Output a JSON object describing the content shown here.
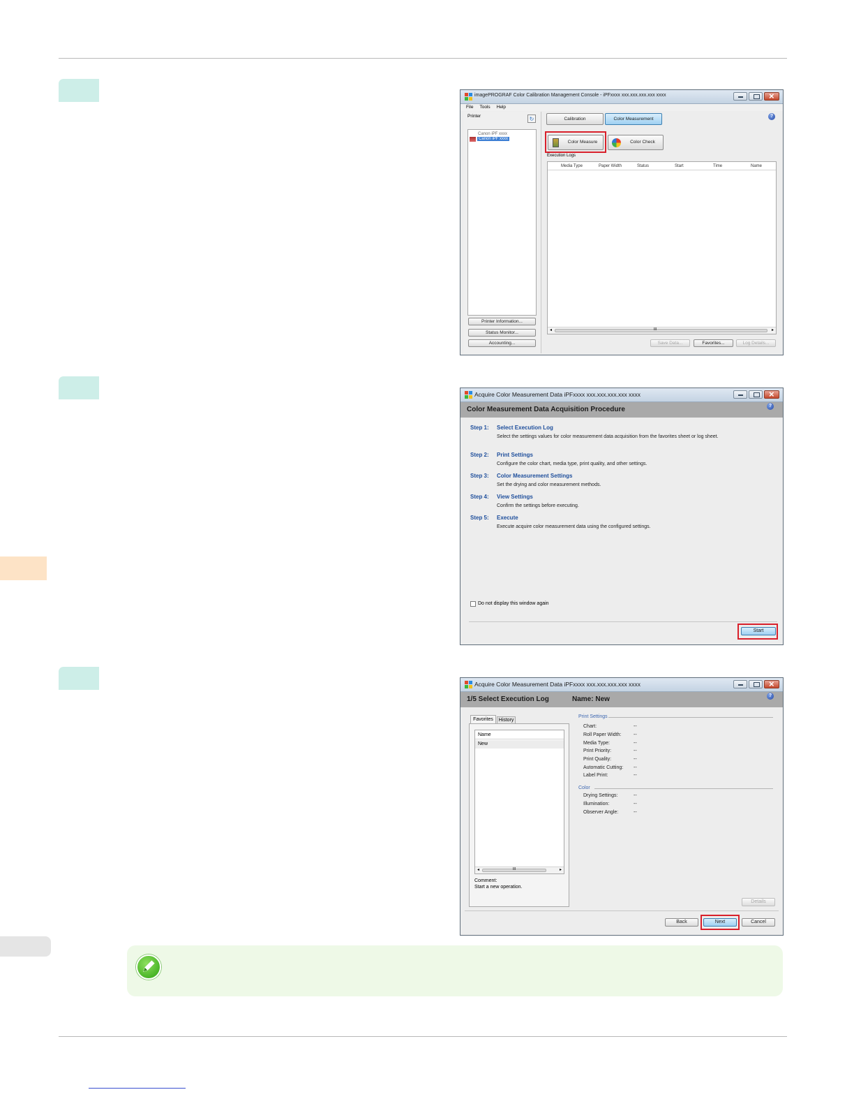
{
  "window1": {
    "title": "imagePROGRAF Color Calibration Management Console - iPFxxxx xxx.xxx.xxx.xxx xxxx",
    "menu": [
      "File",
      "Tools",
      "Help"
    ],
    "printer_label": "Printer",
    "printers": [
      "Canon iPF xxxx",
      "Canon iPF xxxx"
    ],
    "tabs": [
      "Calibration",
      "Color Measurement"
    ],
    "color_measure_button": "Color Measure",
    "color_check_button": "Color Check",
    "execution_logs_label": "Execution Logs",
    "columns": [
      "Media Type",
      "Paper Width",
      "Status",
      "Start",
      "Time",
      "Name"
    ],
    "scroll_mark": "III",
    "left_buttons": [
      "Printer Information...",
      "Status Monitor...",
      "Accounting..."
    ],
    "bottom_buttons": [
      "Save Data...",
      "Favorites...",
      "Log Details..."
    ]
  },
  "window2": {
    "title": "Acquire Color Measurement Data iPFxxxx xxx.xxx.xxx.xxx xxxx",
    "heading": "Color Measurement Data Acquisition Procedure",
    "steps": [
      {
        "num": "Step 1:",
        "title": "Select Execution Log",
        "desc": "Select the settings values for color measurement data acquisition from the favorites sheet or log sheet."
      },
      {
        "num": "Step 2:",
        "title": "Print Settings",
        "desc": "Configure the color chart, media type, print quality, and other settings."
      },
      {
        "num": "Step 3:",
        "title": "Color Measurement Settings",
        "desc": "Set the drying and color measurement methods."
      },
      {
        "num": "Step 4:",
        "title": "View Settings",
        "desc": "Confirm the settings before executing."
      },
      {
        "num": "Step 5:",
        "title": "Execute",
        "desc": "Execute acquire color measurement data using the configured settings."
      }
    ],
    "checkbox_label": "Do not display this window again",
    "start_button": "Start"
  },
  "window3": {
    "title": "Acquire Color Measurement Data iPFxxxx xxx.xxx.xxx.xxx xxxx",
    "heading": "1/5 Select Execution Log",
    "name_label": "Name: New",
    "tabs": [
      "Favorites",
      "History"
    ],
    "list_header": "Name",
    "list_items": [
      "New"
    ],
    "scroll_mark": "III",
    "comment_label": "Comment:",
    "comment_text": "Start a new operation.",
    "print_settings_label": "Print Settings",
    "print_settings": [
      {
        "key": "Chart:",
        "value": "--"
      },
      {
        "key": "Roll Paper Width:",
        "value": "--"
      },
      {
        "key": "Media Type:",
        "value": "--"
      },
      {
        "key": "Print Priority:",
        "value": "--"
      },
      {
        "key": "Print Quality:",
        "value": "--"
      },
      {
        "key": "Automatic Cutting:",
        "value": "--"
      },
      {
        "key": "Label Print:",
        "value": "--"
      }
    ],
    "color_label": "Color",
    "color_settings": [
      {
        "key": "Drying Settings:",
        "value": "--"
      },
      {
        "key": "Illumination:",
        "value": "--"
      },
      {
        "key": "Observer Angle:",
        "value": "--"
      }
    ],
    "details_button": "Details",
    "back_button": "Back",
    "next_button": "Next",
    "cancel_button": "Cancel"
  },
  "colors": {
    "step_tab": "#cdeee8",
    "side_tab": "#fde3c6",
    "note_bg": "#eef9e7",
    "highlight": "#d8202b",
    "step_text": "#1f4f9c"
  }
}
